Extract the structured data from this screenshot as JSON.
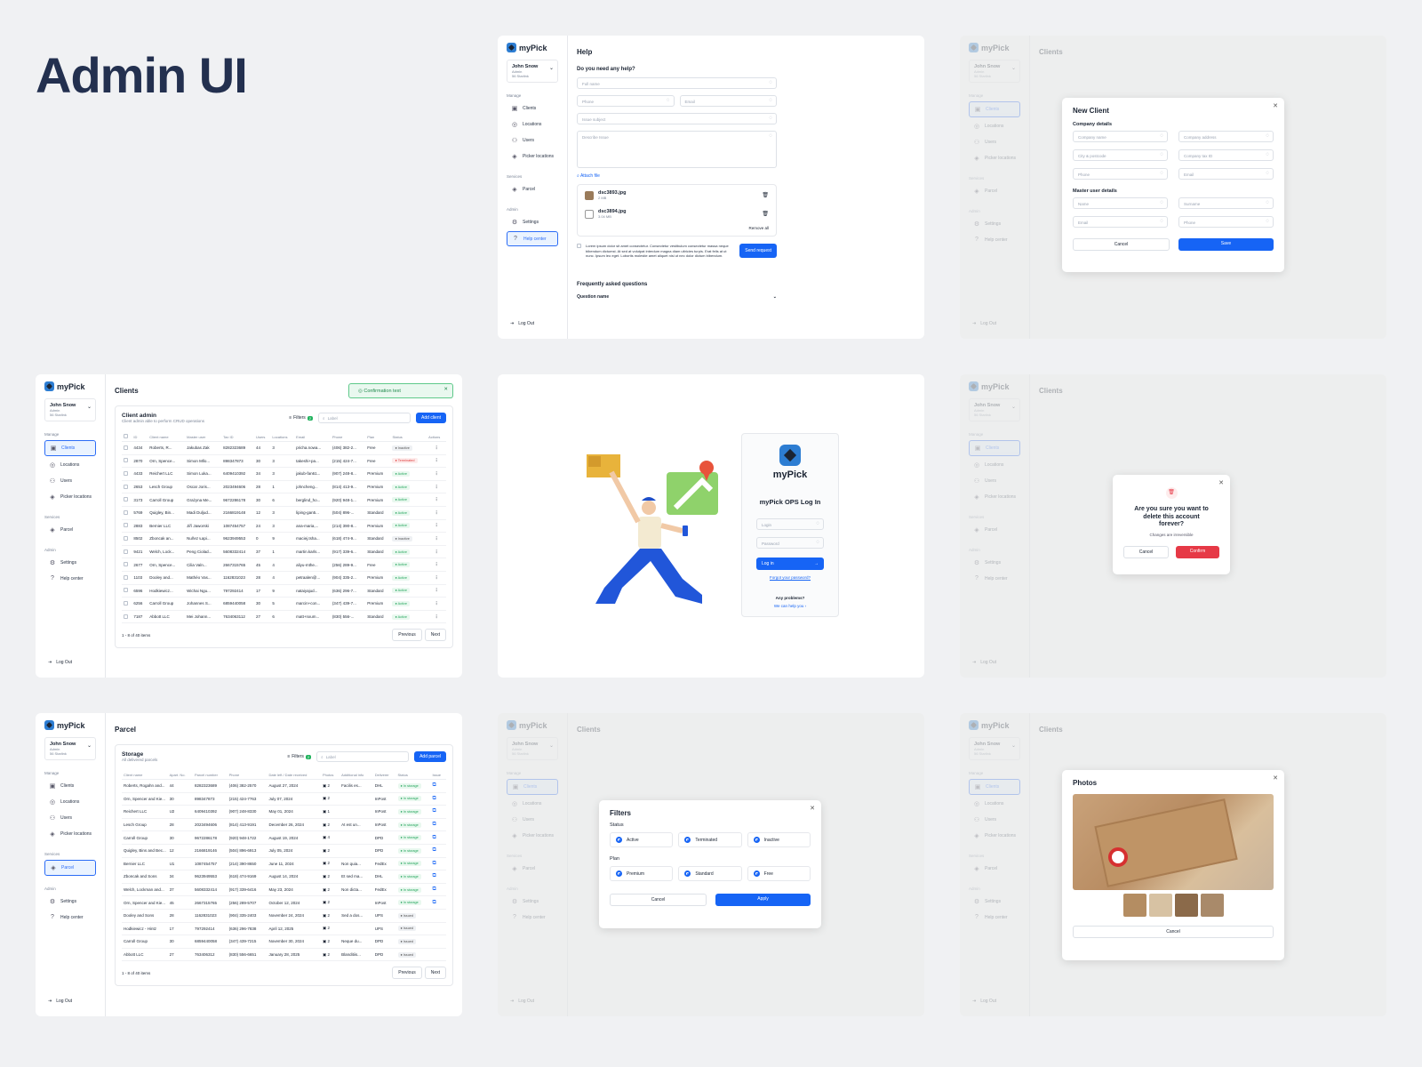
{
  "heading": "Admin UI",
  "logo": "myPick",
  "user": {
    "name": "John Snow",
    "role": "Admin",
    "location": "56 Starlink"
  },
  "nav": {
    "manage": "Manage",
    "services": "Services",
    "admin": "Admin",
    "clients": "Clients",
    "locations": "Locations",
    "users": "Users",
    "picker": "Picker locations",
    "parcel": "Parcel",
    "settings": "Settings",
    "help": "Help center",
    "logout": "Log Out"
  },
  "help": {
    "title": "Help",
    "question": "Do you need any help?",
    "full_name": "Full name",
    "phone": "Phone",
    "email": "Email",
    "subject": "Issue subject",
    "describe": "Describe Issue",
    "attach": "Attach file",
    "files": [
      {
        "name": "dsc3893.jpg",
        "size": "2 MB"
      },
      {
        "name": "dsc3894.jpg",
        "size": "3.04 MB"
      }
    ],
    "remove_all": "Remove all",
    "consent": "Lorem ipsum dolor sit amet consectetur. Consectetur vestibulum consectetur massa neque bibendum dictumst. At sed at volutpat interdum magna diam ultricies turpis. Erat felis at ut nunc. Ipsum leo eget. Lobortis molestie amet aliquet nisi ut nec dolor dictum bibendum.",
    "send": "Send request",
    "faq": "Frequently asked questions",
    "faq_q": "Question name"
  },
  "new_client": {
    "page_title": "Clients",
    "title": "New Client",
    "company": "Company details",
    "company_name": "Company name",
    "company_address": "Company address",
    "city": "City & postcode",
    "tax": "Company tax ID",
    "phone": "Phone",
    "email": "Email",
    "master": "Master user details",
    "name": "Name",
    "surname": "Surname",
    "email2": "Email",
    "phone2": "Phone",
    "cancel": "Cancel",
    "save": "Save"
  },
  "clients": {
    "title": "Clients",
    "toast": "Confirmation text",
    "card_title": "Client admin",
    "card_sub": "Client admin able to perform CRUD operations",
    "filters": "Filters",
    "filter_count": "2",
    "search": "Label",
    "add": "Add client",
    "headers": [
      "ID",
      "Client name",
      "Master user",
      "Tax ID",
      "Users",
      "Locations",
      "Email",
      "Phone",
      "Plan",
      "Status",
      "Actions"
    ],
    "rows": [
      [
        "4434",
        "Roberts, R...",
        "Jakubas Zak",
        "8282323689",
        "44",
        "3",
        "pricha.nowa...",
        "(406) 382-2...",
        "Free",
        "Inactive"
      ],
      [
        "2870",
        "Orn, Spence...",
        "Simon Mllo...",
        "898347873",
        "30",
        "3",
        "takeshi+pa...",
        "(215) 424-7...",
        "Free",
        "Terminated"
      ],
      [
        "4433",
        "Reichert LLC",
        "Simon Luka...",
        "6409410392",
        "34",
        "3",
        "jakub-fan61...",
        "(907) 248-8...",
        "Premium",
        "Active"
      ],
      [
        "2653",
        "Lesch Group",
        "Oscar Joris...",
        "2023494606",
        "28",
        "1",
        "johncheng...",
        "(814) 413-9...",
        "Premium",
        "Active"
      ],
      [
        "3173",
        "Carroll Group",
        "Grażyna Me...",
        "9672286178",
        "30",
        "6",
        "berglind_ho...",
        "(920) 948-1...",
        "Premium",
        "Active"
      ],
      [
        "5769",
        "Quigley, Bin...",
        "Madi Duljud...",
        "2166819148",
        "12",
        "3",
        "liping-gan5...",
        "(504) 896-...",
        "Standard",
        "Active"
      ],
      [
        "2883",
        "Bernier LLC",
        "Jiří Jaworski",
        "1087454757",
        "24",
        "3",
        "ana-maria,...",
        "(214) 390-8...",
        "Premium",
        "Active"
      ],
      [
        "8502",
        "Zboncak an...",
        "Nuñez Łapi...",
        "9623949553",
        "0",
        "9",
        "maciej.tsha...",
        "(618) 474-9...",
        "Standard",
        "Inactive"
      ],
      [
        "9421",
        "Welch, Lock...",
        "Peng Ciolad...",
        "5608332414",
        "37",
        "1",
        "martin.karls...",
        "(917) 339-6...",
        "Standard",
        "Active"
      ],
      [
        "2677",
        "Orn, Spence...",
        "Cilia Valn...",
        "2667315765",
        "45",
        "4",
        "aliyu-mthe...",
        "(256) 289-9...",
        "Free",
        "Active"
      ],
      [
        "1103",
        "Dooley and...",
        "Mathéo Vas...",
        "1162831023",
        "28",
        "4",
        "petraalen@...",
        "(904) 335-2...",
        "Premium",
        "Active"
      ],
      [
        "6596",
        "Hodkiewicz...",
        "Wichai Ngu...",
        "797292414",
        "17",
        "9",
        "nataiyajud...",
        "(636) 296-7...",
        "Standard",
        "Active"
      ],
      [
        "6256",
        "Carroll Group",
        "Johannes S...",
        "6859440058",
        "30",
        "5",
        "marcin+con...",
        "(347) 439-7...",
        "Premium",
        "Active"
      ],
      [
        "7187",
        "Abbott LLC",
        "Mei Johann...",
        "7634063112",
        "27",
        "6",
        "matt+nxum...",
        "(830) 556-...",
        "Standard",
        "Active"
      ]
    ],
    "pager_text": "1 - 8 of 40 items",
    "prev": "Previous",
    "next": "Next"
  },
  "login": {
    "brand": "myPick",
    "title": "myPick OPS Log In",
    "login": "Login",
    "password": "Password",
    "button": "Log in",
    "forgot": "Forgot your password?",
    "problems": "Any problems?",
    "help": "We can help you"
  },
  "delete": {
    "title": "Are you sure you want to delete this account forever?",
    "sub": "Changes are irreversible",
    "cancel": "Cancel",
    "confirm": "Confirm"
  },
  "parcel": {
    "title": "Parcel",
    "card_title": "Storage",
    "card_sub": "All delivered parcels",
    "filters": "Filters",
    "filter_count": "2",
    "search": "Label",
    "add": "Add parcel",
    "headers": [
      "Client name",
      "Apart. No.",
      "Parcel number",
      "Phone",
      "Date left / Date received",
      "Photos",
      "Additional info",
      "Deliverer",
      "Status",
      "Issue"
    ],
    "rows": [
      [
        "Roberts, Rogahn and...",
        "44",
        "8282323689",
        "(406) 382-2570",
        "August 27, 2024",
        "2",
        "Facilis es...",
        "DHL",
        "In storage"
      ],
      [
        "Orn, Spencer and Kie...",
        "30",
        "898347873",
        "(215) 424-7763",
        "July 07, 2024",
        "2",
        "",
        "InPost",
        "In storage"
      ],
      [
        "Reichert LLC",
        "U2",
        "6409410392",
        "(907) 248-8330",
        "May 01, 2024",
        "1",
        "",
        "InPost",
        "In storage"
      ],
      [
        "Lesch Group",
        "28",
        "2023494606",
        "(814) 413-9191",
        "December 26, 2024",
        "2",
        "At est un...",
        "InPost",
        "In storage"
      ],
      [
        "Carroll Group",
        "30",
        "9672286178",
        "(920) 948-1722",
        "August 19, 2024",
        "4",
        "",
        "DPD",
        "In storage"
      ],
      [
        "Quigley, Bins and Bec...",
        "12",
        "2166819146",
        "(504) 896-6913",
        "July 05, 2024",
        "2",
        "",
        "DPD",
        "In storage"
      ],
      [
        "Bernier LLC",
        "U1",
        "1087454757",
        "(214) 390-8650",
        "June 11, 2024",
        "2",
        "Non quia...",
        "FedEx",
        "In storage"
      ],
      [
        "Zboncak and Sons",
        "34",
        "9623949553",
        "(618) 474-9169",
        "August 14, 2024",
        "2",
        "Et sed ma...",
        "DHL",
        "In storage"
      ],
      [
        "Welch, Lockman and...",
        "37",
        "5608332414",
        "(917) 339-6416",
        "May 23, 2024",
        "2",
        "Non dicta...",
        "FedEx",
        "In storage"
      ],
      [
        "Orn, Spencer and Kie...",
        "45",
        "2667315765",
        "(256) 289-5707",
        "October 12, 2024",
        "2",
        "",
        "InPost",
        "In storage"
      ],
      [
        "Dooley and Sons",
        "28",
        "1162831023",
        "(904) 335-2403",
        "November 24, 2024",
        "2",
        "Sed a dos...",
        "UPS",
        "Issued"
      ],
      [
        "Hodkiewicz - Hintz",
        "17",
        "797292414",
        "(636) 296-7838",
        "April 12, 2025",
        "2",
        "",
        "UPS",
        "Issued"
      ],
      [
        "Carroll Group",
        "30",
        "6859440058",
        "(347) 439-7215",
        "November 30, 2024",
        "2",
        "Neque du...",
        "DPD",
        "Issued"
      ],
      [
        "Abbott LLC",
        "27",
        "763406312",
        "(830) 556-6651",
        "January 28, 2025",
        "2",
        "Blanditiis...",
        "DPD",
        "Issued"
      ]
    ],
    "pager_text": "1 - 8 of 40 items",
    "prev": "Previous",
    "next": "Next"
  },
  "filters_modal": {
    "title": "Filters",
    "status": "Status",
    "active": "Active",
    "terminated": "Terminated",
    "inactive": "Inactive",
    "plan": "Plan",
    "premium": "Premium",
    "standard": "Standard",
    "free": "Free",
    "cancel": "Cancel",
    "apply": "Apply"
  },
  "photos": {
    "title": "Photos",
    "cancel": "Cancel"
  },
  "colors": {
    "primary": "#1664f5",
    "active": "#22a55b",
    "danger": "#e63946"
  }
}
